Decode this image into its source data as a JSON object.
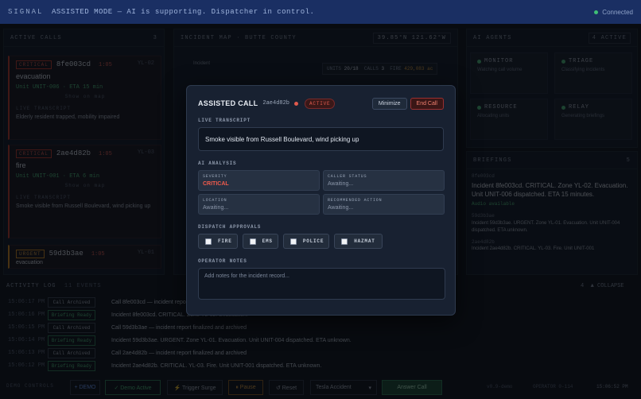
{
  "topbar": {
    "logo": "SIGNAL",
    "mode": "ASSISTED MODE — AI is supporting. Dispatcher in control.",
    "status": "Connected"
  },
  "calls_panel": {
    "title": "ACTIVE CALLS",
    "count": "3",
    "cards": [
      {
        "severity": "CRITICAL",
        "id": "8fe003cd",
        "age": "1:05",
        "zone": "YL-02",
        "type": "evacuation",
        "unit": "Unit UNIT-006 · ETA 15 min",
        "map_link": "Show on map",
        "transcript_label": "LIVE TRANSCRIPT",
        "transcript": "Elderly resident trapped, mobility impaired"
      },
      {
        "severity": "CRITICAL",
        "id": "2ae4d82b",
        "age": "1:05",
        "zone": "YL-03",
        "type": "fire",
        "unit": "Unit UNIT-001 · ETA 6 min",
        "map_link": "Show on map",
        "transcript_label": "LIVE TRANSCRIPT",
        "transcript": "Smoke visible from Russell Boulevard, wind picking up"
      },
      {
        "severity": "URGENT",
        "id": "59d3b3ae",
        "age": "1:05",
        "zone": "YL-01",
        "type": "evacuation"
      }
    ]
  },
  "map_panel": {
    "title": "INCIDENT MAP · BUTTE COUNTY",
    "coords": "39.85°N 121.62°W",
    "legend": "Incident",
    "units_label": "UNITS",
    "units": "20/18",
    "calls_label": "CALLS",
    "calls": "3",
    "fire_label": "FIRE",
    "fire": "429,083 ac"
  },
  "agents_panel": {
    "title": "AI AGENTS",
    "active": "4 ACTIVE",
    "agents": [
      {
        "name": "MONITOR",
        "desc": "Watching call volume"
      },
      {
        "name": "TRIAGE",
        "desc": "Classifying incidents"
      },
      {
        "name": "RESOURCE",
        "desc": "Allocating units"
      },
      {
        "name": "RELAY",
        "desc": "Generating briefings"
      }
    ]
  },
  "briefings": {
    "title": "BRIEFINGS",
    "count": "5",
    "items": [
      {
        "id": "8fe003cd",
        "text": "Incident 8fe003cd. CRITICAL. Zone YL-02. Evacuation. Unit UNIT-006 dispatched. ETA 15 minutes.",
        "audio": "Audio available"
      },
      {
        "id": "59d3b3ae",
        "text": "Incident 59d3b3ae. URGENT. Zone YL-01. Evacuation. Unit UNIT-004 dispatched. ETA unknown."
      },
      {
        "id": "2ae4d82b",
        "text": "Incident 2ae4d82b. CRITICAL. YL-03. Fire. Unit UNIT-001"
      }
    ],
    "collapse": "COLLAPSE",
    "collapse_count": "4"
  },
  "activity_log": {
    "title": "ACTIVITY LOG",
    "subtitle": "11 EVENTS",
    "rows": [
      {
        "time": "15:06:17 PM",
        "tag": "Call Archived",
        "text": "Call 8fe003cd — incident report finalized and archived"
      },
      {
        "time": "15:06:16 PM",
        "tag": "Briefing Ready",
        "text": "Incident 8fe003cd. CRITICAL. Zone YL-02. Evacuation."
      },
      {
        "time": "15:06:15 PM",
        "tag": "Call Archived",
        "text": "Call 59d3b3ae — incident report finalized and archived"
      },
      {
        "time": "15:06:14 PM",
        "tag": "Briefing Ready",
        "text": "Incident 59d3b3ae. URGENT. Zone YL-01. Evacuation. Unit UNIT-004 dispatched. ETA unknown."
      },
      {
        "time": "15:06:13 PM",
        "tag": "Call Archived",
        "text": "Call 2ae4d82b — incident report finalized and archived"
      },
      {
        "time": "15:06:12 PM",
        "tag": "Briefing Ready",
        "text": "Incident 2ae4d82b. CRITICAL. YL-03. Fire. Unit UNIT-001 dispatched. ETA unknown."
      }
    ]
  },
  "controls": {
    "label": "DEMO CONTROLS",
    "mode": "+ DEMO",
    "demo_active": "✓ Demo Active",
    "surge": "⚡ Trigger Surge",
    "pause": "⏸ Pause",
    "reset": "↺ Reset",
    "scenario": "Tesla Accident",
    "answer": "Answer Call",
    "version": "v0.9-demo",
    "operator": "OPERATOR 0-114",
    "clock": "15:06:52 PM"
  },
  "modal": {
    "title": "ASSISTED CALL",
    "call_id": "2ae4d82b",
    "badge": "ACTIVE",
    "minimize": "Minimize",
    "end_call": "End Call",
    "transcript_label": "LIVE TRANSCRIPT",
    "transcript": "Smoke visible from Russell Boulevard, wind picking up",
    "analysis_label": "AI ANALYSIS",
    "fields": [
      {
        "key": "SEVERITY",
        "value": "CRITICAL"
      },
      {
        "key": "CALLER STATUS",
        "value": "Awaiting..."
      },
      {
        "key": "LOCATION",
        "value": "Awaiting..."
      },
      {
        "key": "RECOMMENDED ACTION",
        "value": "Awaiting..."
      }
    ],
    "approvals_label": "DISPATCH APPROVALS",
    "approvals": [
      "FIRE",
      "EMS",
      "POLICE",
      "HAZMAT"
    ],
    "notes_label": "OPERATOR NOTES",
    "notes_placeholder": "Add notes for the incident record..."
  },
  "colors": {
    "banner": "#1a2f63",
    "critical": "#f05b4c",
    "success": "#4ec07b",
    "modal_bg": "#182131"
  }
}
